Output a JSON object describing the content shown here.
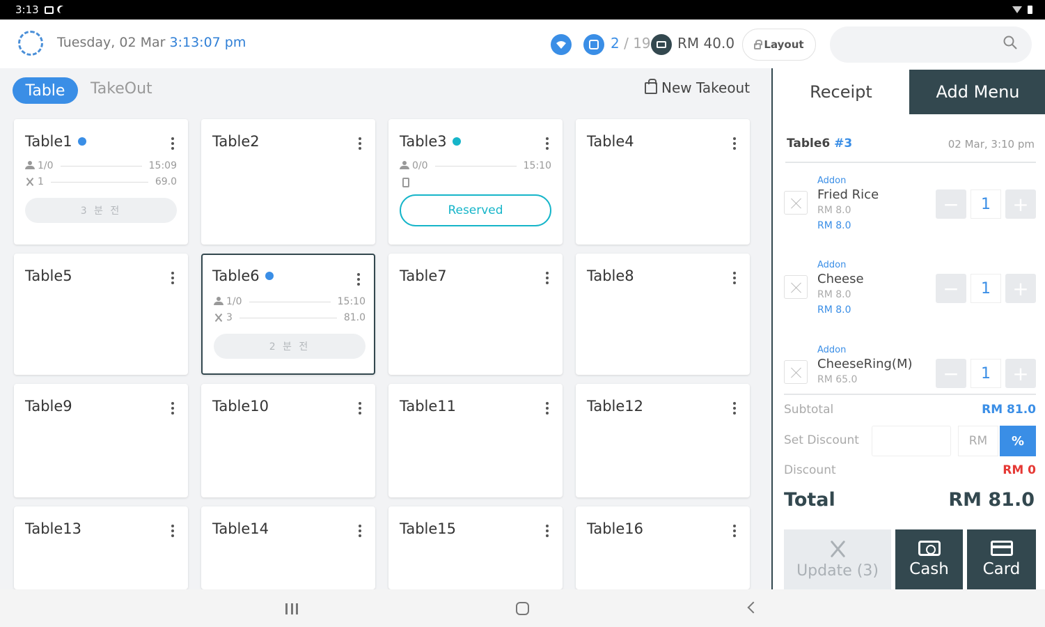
{
  "status_bar": {
    "time": "3:13"
  },
  "header": {
    "day": "Tuesday, 02 Mar",
    "time": "3:13:07 pm",
    "orders_active": "2",
    "orders_total": "19",
    "amount": "RM 40.0",
    "layout_label": "Layout",
    "search_placeholder": ""
  },
  "tabs": {
    "table": "Table",
    "takeout": "TakeOut",
    "new_takeout": "New Takeout"
  },
  "tables": [
    {
      "name": "Table1",
      "dot": "blue",
      "guests": "1/0",
      "time": "15:09",
      "items": "1",
      "amount": "69.0",
      "pill": "3 분 전"
    },
    {
      "name": "Table2"
    },
    {
      "name": "Table3",
      "dot": "cyan",
      "guests": "0/0",
      "time": "15:10",
      "reserved": "Reserved"
    },
    {
      "name": "Table4"
    },
    {
      "name": "Table5"
    },
    {
      "name": "Table6",
      "dot": "blue",
      "guests": "1/0",
      "time": "15:10",
      "items": "3",
      "amount": "81.0",
      "pill": "2 분 전",
      "selected": true
    },
    {
      "name": "Table7"
    },
    {
      "name": "Table8"
    },
    {
      "name": "Table9"
    },
    {
      "name": "Table10"
    },
    {
      "name": "Table11"
    },
    {
      "name": "Table12"
    },
    {
      "name": "Table13"
    },
    {
      "name": "Table14"
    },
    {
      "name": "Table15"
    },
    {
      "name": "Table16"
    }
  ],
  "panel": {
    "tab_receipt": "Receipt",
    "tab_add_menu": "Add Menu",
    "receipt_table": "Table6",
    "receipt_no": "#3",
    "receipt_date": "02 Mar, 3:10 pm",
    "items": [
      {
        "addon": "Addon",
        "name": "Fried Rice",
        "price": "RM 8.0",
        "line_total": "RM 8.0",
        "qty": "1"
      },
      {
        "addon": "Addon",
        "name": "Cheese",
        "price": "RM 8.0",
        "line_total": "RM 8.0",
        "qty": "1"
      },
      {
        "addon": "Addon",
        "name": "CheeseRing(M)",
        "price": "RM 65.0",
        "line_total": "",
        "qty": "1"
      }
    ],
    "minus_symbol": "−",
    "plus_symbol": "+",
    "subtotal_label": "Subtotal",
    "subtotal_value": "RM 81.0",
    "set_discount_label": "Set Discount",
    "rm_label": "RM",
    "percent_label": "%",
    "discount_label": "Discount",
    "discount_value": "RM 0",
    "total_label": "Total",
    "total_value": "RM 81.0",
    "update_label": "Update (3)",
    "cash_label": "Cash",
    "card_label": "Card"
  },
  "colors": {
    "accent": "#3a8ee6",
    "dark": "#33484f",
    "reserved": "#16b5c9",
    "discount_red": "#e53935"
  }
}
